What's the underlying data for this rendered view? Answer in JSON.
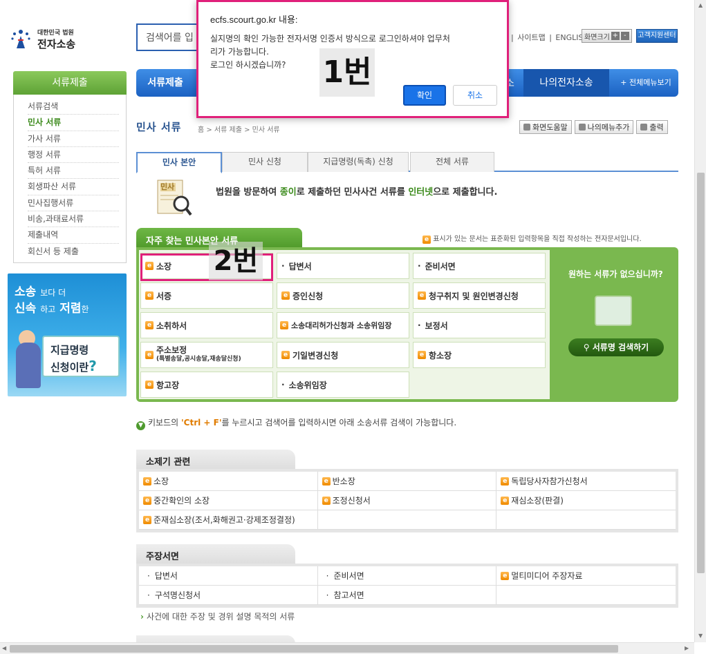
{
  "logo": {
    "line1": "대한민국 법원",
    "line2": "전자소송"
  },
  "search": {
    "value": "검색어를 입"
  },
  "toplinks": [
    "|",
    "사이트맵",
    "|",
    "ENGLISH"
  ],
  "fontsize": {
    "label": "화면크기",
    "plus": "+",
    "minus": "-"
  },
  "helpcenter": "고객지원센터",
  "mainnav": {
    "first": "서류제출",
    "partial": "소",
    "mine": "나의전자소송",
    "allmenu": "+ 전체메뉴보기"
  },
  "sidebar": {
    "title": "서류제출",
    "items": [
      "서류검색",
      "민사 서류",
      "가사 서류",
      "행정 서류",
      "특허 서류",
      "회생파산 서류",
      "민사집행서류",
      "비송,과태료서류",
      "제출내역",
      "회신서 등 제출"
    ]
  },
  "banner": {
    "l1a": "소송",
    "l1b": "보다 더",
    "l2a": "신속",
    "l2b": "하고",
    "l2c": "저렴",
    "l2d": "한",
    "c1": "지급명령",
    "c2": "신청이란",
    "q": "?"
  },
  "page": {
    "title": "민사 서류",
    "breadcrumb": "홈 > 서류 제출 > 민사 서류",
    "tools": [
      "화면도움말",
      "나의메뉴추가",
      "출력"
    ]
  },
  "tabs": [
    "민사 본안",
    "민사 신청",
    "지급명령(독촉) 신청",
    "전체 서류"
  ],
  "intro": {
    "icon_label": "민사",
    "t1": "법원을 방문하여 ",
    "t2": "종이",
    "t3": "로 제출하던 민사사건 서류를 ",
    "t4": "인터넷",
    "t5": "으로 제출합니다."
  },
  "freq": {
    "title": "자주 찾는 민사본안 서류",
    "note": "표시가 있는 문서는 표준화된 입력항목을 직접 작성하는 전자문서입니다.",
    "cells": [
      {
        "label": "소장",
        "e": true
      },
      {
        "label": "답변서",
        "e": false
      },
      {
        "label": "준비서면",
        "e": false
      },
      {
        "label": "서증",
        "e": true
      },
      {
        "label": "증인신청",
        "e": true
      },
      {
        "label": "청구취지 및 원인변경신청",
        "e": true
      },
      {
        "label": "소취하서",
        "e": true
      },
      {
        "label": "소송대리허가신청과 소송위임장",
        "e": true
      },
      {
        "label": "보정서",
        "e": false
      },
      {
        "label": "주소보정",
        "sub": "(특별송달,공시송달,재송달신청)",
        "e": true
      },
      {
        "label": "기일변경신청",
        "e": true
      },
      {
        "label": "항소장",
        "e": true
      },
      {
        "label": "항고장",
        "e": true
      },
      {
        "label": "소송위임장",
        "e": false
      }
    ],
    "side_q": "원하는 서류가 없으십니까?",
    "side_btn": "서류명 검색하기"
  },
  "kbtip": {
    "a": "키보드의 ",
    "b": "'Ctrl + F'",
    "c": "를 누르시고 검색어를 입력하시면 아래 소송서류 검색이 가능합니다."
  },
  "sec1": {
    "title": "소제기 관련",
    "rows": [
      [
        {
          "label": "소장",
          "e": true
        },
        {
          "label": "반소장",
          "e": true
        },
        {
          "label": "독립당사자참가신청서",
          "e": true
        }
      ],
      [
        {
          "label": "중간확인의 소장",
          "e": true
        },
        {
          "label": "조정신청서",
          "e": true
        },
        {
          "label": "재심소장(판결)",
          "e": true
        }
      ],
      [
        {
          "label": "준재심소장(조서,화해권고·강제조정결정)",
          "e": true
        },
        {
          "label": "",
          "e": false
        },
        {
          "label": "",
          "e": false
        }
      ]
    ]
  },
  "sec2": {
    "title": "주장서면",
    "rows": [
      [
        {
          "label": "답변서",
          "e": false
        },
        {
          "label": "준비서면",
          "e": false
        },
        {
          "label": "멀티미디어 주장자료",
          "e": true
        }
      ],
      [
        {
          "label": "구석명신청서",
          "e": false
        },
        {
          "label": "참고서면",
          "e": false
        },
        {
          "label": "",
          "e": false
        }
      ]
    ],
    "note": "사건에 대한 주장 및 경위 설명 목적의 서류"
  },
  "dialog": {
    "title": "ecfs.scourt.go.kr 내용:",
    "line1": "실지명의 확인 가능한 전자서명 인증서 방식으로 로그인하셔야 업무처",
    "line2": "리가 가능합니다.",
    "line3": "로그인 하시겠습니까?",
    "ok": "확인",
    "cancel": "취소"
  },
  "annotations": {
    "a1": "1번",
    "a2": "2번"
  },
  "e_mark": "e"
}
